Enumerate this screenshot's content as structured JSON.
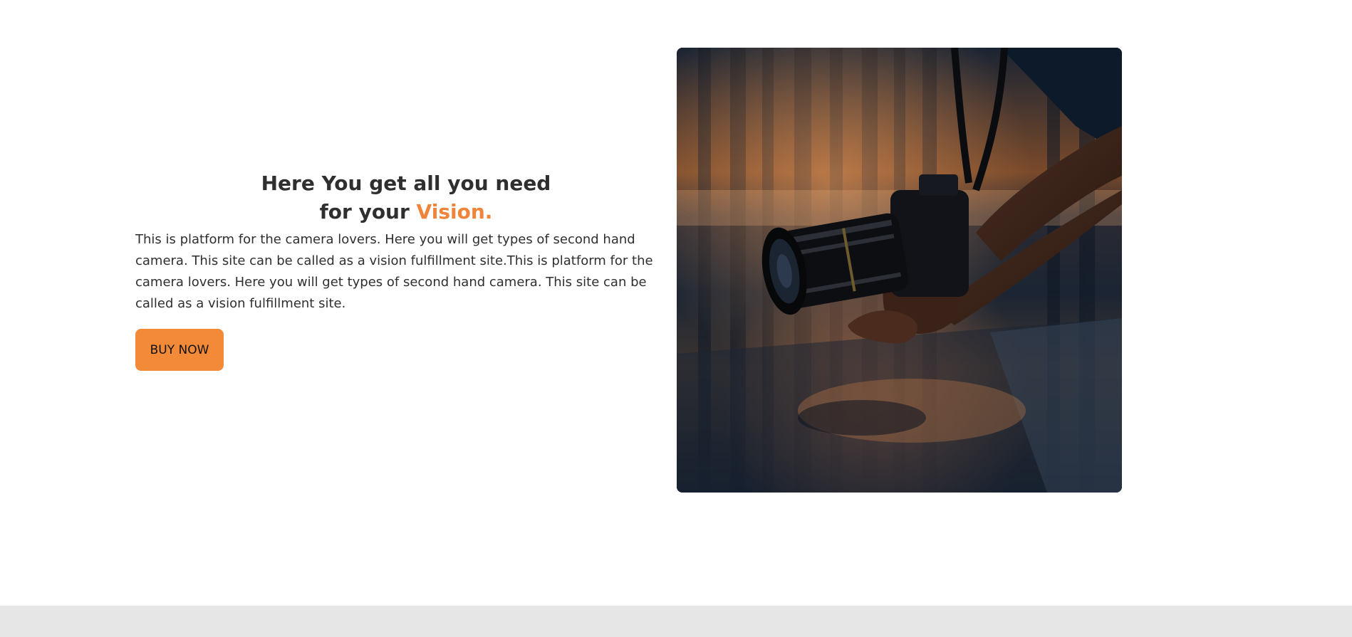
{
  "hero": {
    "headline_line1": "Here You get all you need",
    "headline_line2_prefix": "for your ",
    "headline_accent": "Vision.",
    "description": "This is platform for the camera lovers. Here you will get types of second hand camera. This site can be called as a vision fulfillment site.This is platform for the camera lovers. Here you will get types of second hand camera. This site can be called as a vision fulfillment site.",
    "buy_button_label": "BUY NOW",
    "image_alt": "hands holding a DSLR camera near a wet reflective street"
  },
  "colors": {
    "accent": "#f0843a",
    "button_bg": "#f28a38",
    "text": "#2f2f2f",
    "footer_bg": "#e6e6e6"
  }
}
